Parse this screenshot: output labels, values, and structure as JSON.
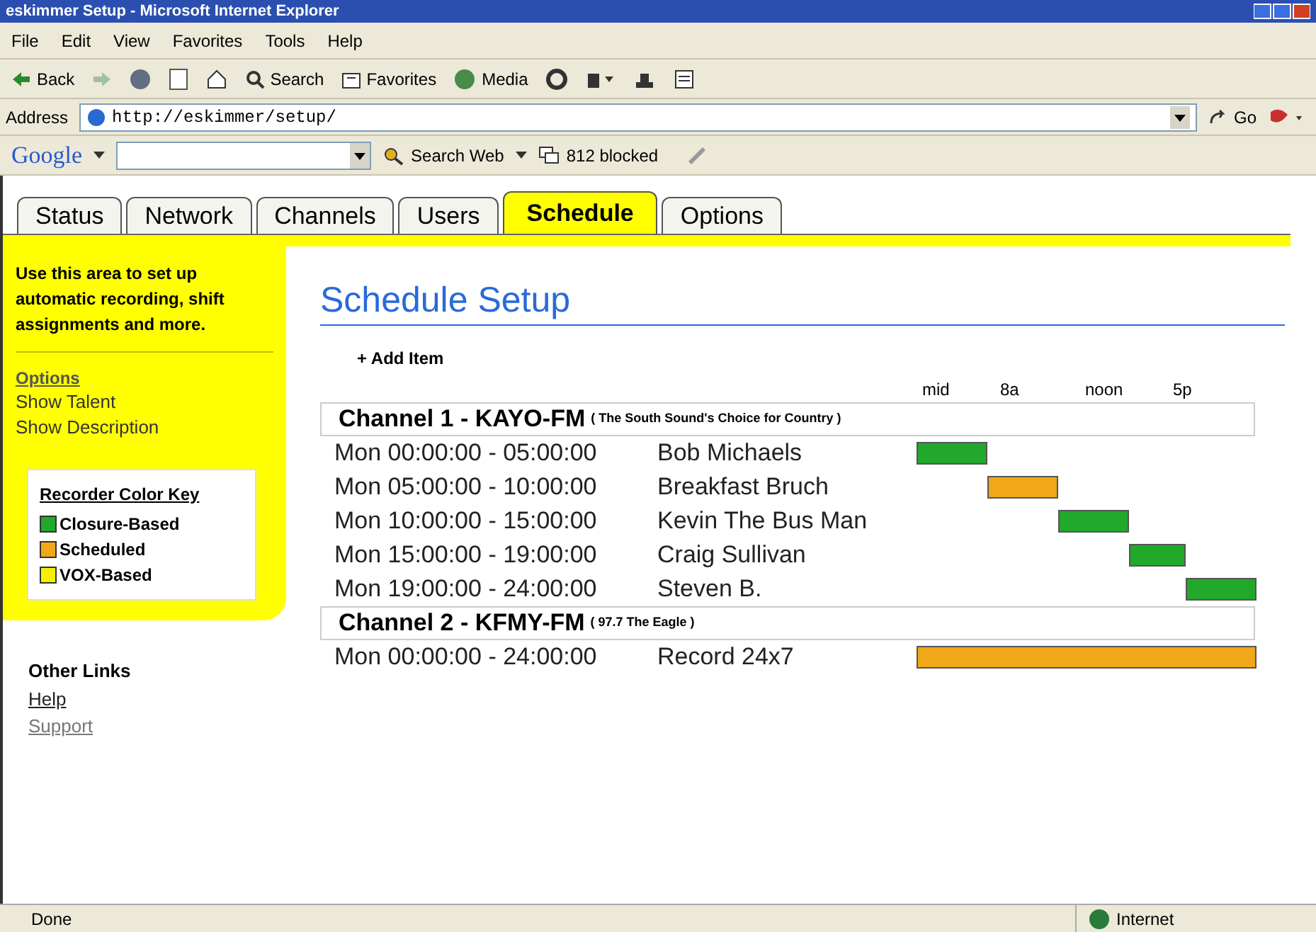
{
  "window": {
    "title": "eskimmer Setup - Microsoft Internet Explorer"
  },
  "menu": [
    "File",
    "Edit",
    "View",
    "Favorites",
    "Tools",
    "Help"
  ],
  "toolbar": {
    "back": "Back",
    "search": "Search",
    "favorites": "Favorites",
    "media": "Media"
  },
  "address_bar": {
    "label": "Address",
    "url": "http://eskimmer/setup/",
    "go": "Go"
  },
  "google_bar": {
    "logo": "Google",
    "search_button": "Search Web",
    "blocked": "812 blocked"
  },
  "tabs": [
    {
      "label": "Status",
      "selected": false
    },
    {
      "label": "Network",
      "selected": false
    },
    {
      "label": "Channels",
      "selected": false
    },
    {
      "label": "Users",
      "selected": false
    },
    {
      "label": "Schedule",
      "selected": true
    },
    {
      "label": "Options",
      "selected": false
    }
  ],
  "sidebar": {
    "intro": "Use this area to set up automatic recording, shift assignments and more.",
    "options_heading": "Options",
    "options": [
      "Show Talent",
      "Show Description"
    ],
    "color_key": {
      "title": "Recorder Color Key",
      "items": [
        {
          "label": "Closure-Based",
          "color": "#22a82a"
        },
        {
          "label": "Scheduled",
          "color": "#f0a818"
        },
        {
          "label": "VOX-Based",
          "color": "#f5f000"
        }
      ]
    },
    "other_links_heading": "Other Links",
    "links": [
      "Help",
      "Support"
    ]
  },
  "main": {
    "title": "Schedule Setup",
    "add_item": "+ Add Item",
    "timeline_labels": [
      "mid",
      "8a",
      "noon",
      "5p"
    ],
    "channels": [
      {
        "name": "Channel 1 - KAYO-FM",
        "tagline": "( The South Sound's Choice for Country )",
        "rows": [
          {
            "time": "Mon 00:00:00 - 05:00:00",
            "talent": "Bob Michaels",
            "color": "#22a82a"
          },
          {
            "time": "Mon 05:00:00 - 10:00:00",
            "talent": "Breakfast Bruch",
            "color": "#f0a818"
          },
          {
            "time": "Mon 10:00:00 - 15:00:00",
            "talent": "Kevin The Bus Man",
            "color": "#22a82a"
          },
          {
            "time": "Mon 15:00:00 - 19:00:00",
            "talent": "Craig Sullivan",
            "color": "#22a82a"
          },
          {
            "time": "Mon 19:00:00 - 24:00:00",
            "talent": "Steven B.",
            "color": "#22a82a"
          }
        ]
      },
      {
        "name": "Channel 2 - KFMY-FM",
        "tagline": "( 97.7 The Eagle )",
        "rows": [
          {
            "time": "Mon 00:00:00 - 24:00:00",
            "talent": "Record 24x7",
            "color": "#f0a818"
          }
        ]
      }
    ]
  },
  "status_bar": {
    "text": "Done",
    "zone": "Internet"
  }
}
